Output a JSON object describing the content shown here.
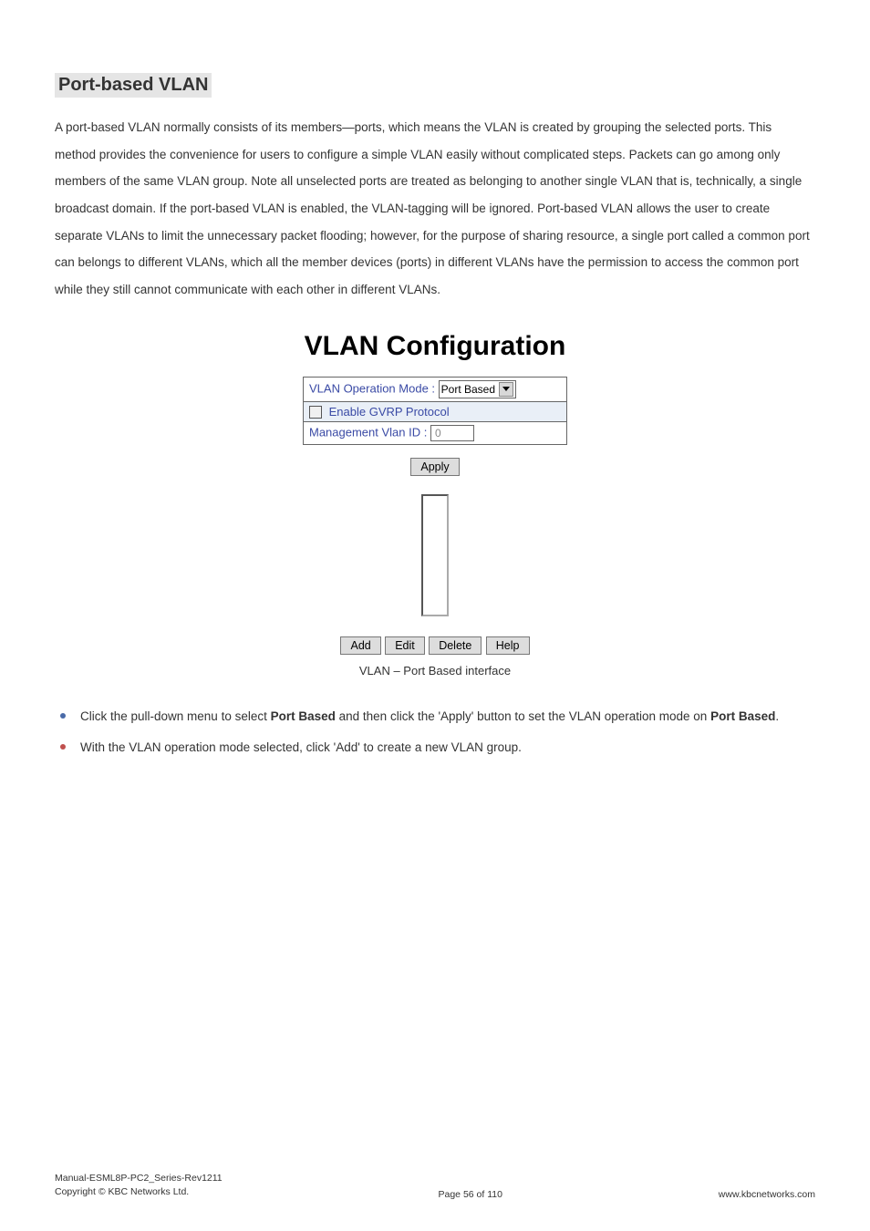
{
  "heading": "Port-based VLAN",
  "paragraph": "A port-based VLAN normally consists of its members—ports, which means the VLAN is created by grouping the selected ports. This method provides the convenience for users to configure a simple VLAN easily without complicated steps. Packets can go among only members of the same VLAN group. Note all unselected ports are treated as belonging to another single VLAN that is, technically, a single broadcast domain. If the port-based VLAN is enabled, the VLAN-tagging will be ignored. Port-based VLAN allows the user to create separate VLANs to limit the unnecessary packet flooding; however, for the purpose of sharing resource, a single port called a common port can belongs to different VLANs, which all the member devices (ports) in different VLANs have the permission to access the common port while they still cannot communicate with each other in different VLANs.",
  "config": {
    "title": "VLAN Configuration",
    "mode_label": "VLAN Operation Mode : ",
    "mode_value": "Port Based",
    "gvrp_label": " Enable GVRP Protocol",
    "mgmt_label": "Management Vlan ID : ",
    "mgmt_value": "0",
    "apply": "Apply",
    "buttons": {
      "add": "Add",
      "edit": "Edit",
      "delete": "Delete",
      "help": "Help"
    }
  },
  "caption": "VLAN – Port Based interface",
  "bullets": [
    {
      "pre": "Click the pull-down menu to select ",
      "bold1": "Port Based",
      "mid": " and then click the 'Apply' button to set the VLAN operation mode on ",
      "bold2": "Port Based",
      "post": "."
    },
    {
      "text": "With the VLAN operation mode selected, click 'Add' to create a new VLAN group."
    }
  ],
  "footer": {
    "line1": "Manual-ESML8P-PC2_Series-Rev1211",
    "line2": "Copyright © KBC Networks Ltd.",
    "center": "Page 56 of 110",
    "right": "www.kbcnetworks.com"
  }
}
